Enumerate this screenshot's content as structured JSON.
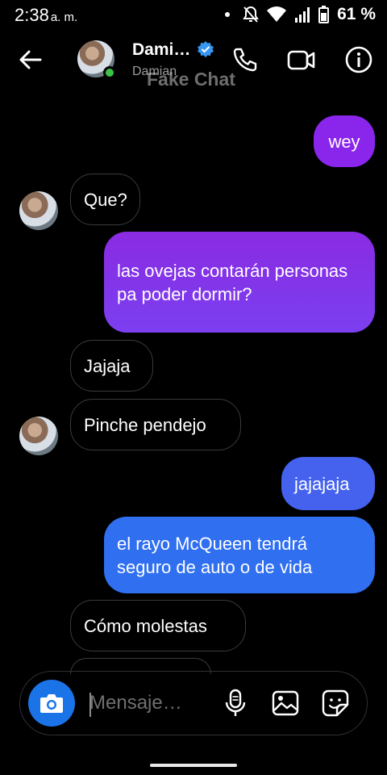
{
  "status_bar": {
    "time": "2:38",
    "ampm": "a. m.",
    "battery": "61 %"
  },
  "header": {
    "contact_name": "Dami…",
    "contact_sub": "Damian",
    "watermark": "Fake Chat"
  },
  "messages": [
    {
      "side": "out",
      "text": "wey"
    },
    {
      "side": "in",
      "text": "Que?",
      "avatar": true
    },
    {
      "side": "out",
      "text": "las ovejas contarán personas pa poder dormir?"
    },
    {
      "side": "in",
      "text": "Jajaja"
    },
    {
      "side": "in",
      "text": "Pinche pendejo",
      "avatar": true
    },
    {
      "side": "out",
      "text": "jajajaja"
    },
    {
      "side": "out",
      "text": "el rayo McQueen tendrá seguro de auto o de vida"
    },
    {
      "side": "in",
      "text": "Cómo molestas"
    }
  ],
  "composer": {
    "placeholder": "Mensaje…"
  },
  "colors": {
    "outgoing_top": "#8a2be2",
    "outgoing_bottom": "#2f6ff0",
    "accent": "#1a74e8",
    "online": "#3ec24a"
  },
  "icons": [
    "back-arrow-icon",
    "verified-badge-icon",
    "phone-icon",
    "video-camera-icon",
    "info-icon",
    "camera-icon",
    "microphone-icon",
    "image-icon",
    "sticker-icon"
  ]
}
